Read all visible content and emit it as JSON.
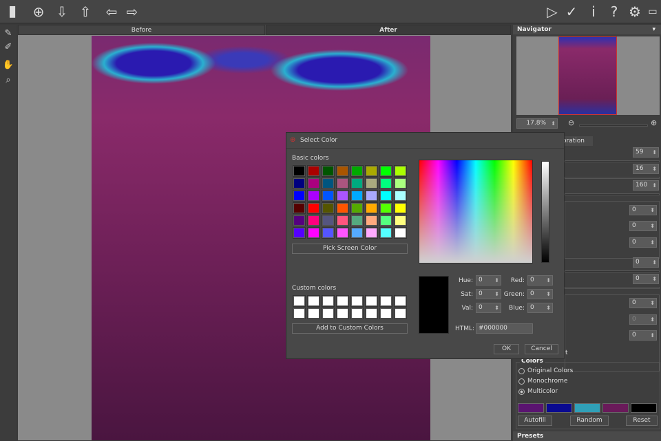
{
  "toolbar": {
    "left_icons": [
      "app-logo-icon",
      "open-icon",
      "import-icon",
      "export-icon",
      "back-arrow-icon",
      "forward-arrow-icon"
    ],
    "right_icons": [
      "play-icon",
      "apply-check-icon",
      "info-icon",
      "help-icon",
      "settings-icon",
      "chat-icon"
    ]
  },
  "view_tabs": {
    "before": "Before",
    "after": "After"
  },
  "navigator": {
    "title": "Navigator",
    "zoom": "17.8%"
  },
  "settings": {
    "tab_label": "oration",
    "values_a": [
      "59",
      "16",
      "160"
    ],
    "values_b": [
      "0",
      "0",
      "0"
    ],
    "values_c": [
      "0",
      "0"
    ],
    "values_d": [
      "0",
      "0",
      "0"
    ],
    "cut_label": "t"
  },
  "colors": {
    "title": "Colors",
    "options": [
      "Original Colors",
      "Monochrome",
      "Multicolor"
    ],
    "selected": "Multicolor",
    "swatches": [
      "#5a1470",
      "#0a0a90",
      "#30a0b8",
      "#6a1a5a",
      "#000000"
    ],
    "autofill": "Autofill",
    "random": "Random",
    "reset": "Reset"
  },
  "presets": {
    "title": "Presets"
  },
  "dialog": {
    "title": "Select Color",
    "basic_colors_label": "Basic colors",
    "basic_colors": [
      "#000000",
      "#aa0000",
      "#005500",
      "#aa5500",
      "#00aa00",
      "#aaaa00",
      "#00ff00",
      "#aaff00",
      "#00007f",
      "#aa007f",
      "#00557f",
      "#aa557f",
      "#00aa7f",
      "#aaaa7f",
      "#00ff7f",
      "#aaff7f",
      "#0000ff",
      "#aa00ff",
      "#0055ff",
      "#aa55ff",
      "#00aaff",
      "#aaaaff",
      "#00ffff",
      "#aaffff",
      "#550000",
      "#ff0000",
      "#555500",
      "#ff5500",
      "#55aa00",
      "#ffaa00",
      "#55ff00",
      "#ffff00",
      "#55007f",
      "#ff007f",
      "#55557f",
      "#ff557f",
      "#55aa7f",
      "#ffaa7f",
      "#55ff7f",
      "#ffff7f",
      "#5500ff",
      "#ff00ff",
      "#5555ff",
      "#ff55ff",
      "#55aaff",
      "#ffaaff",
      "#55ffff",
      "#ffffff"
    ],
    "pick_screen": "Pick Screen Color",
    "custom_colors_label": "Custom colors",
    "add_custom": "Add to Custom Colors",
    "hue_label": "Hue:",
    "sat_label": "Sat:",
    "val_label": "Val:",
    "red_label": "Red:",
    "green_label": "Green:",
    "blue_label": "Blue:",
    "hue": "0",
    "sat": "0",
    "val": "0",
    "red": "0",
    "green": "0",
    "blue": "0",
    "html_label": "HTML:",
    "html": "#000000",
    "ok": "OK",
    "cancel": "Cancel",
    "current_color": "#000000"
  }
}
